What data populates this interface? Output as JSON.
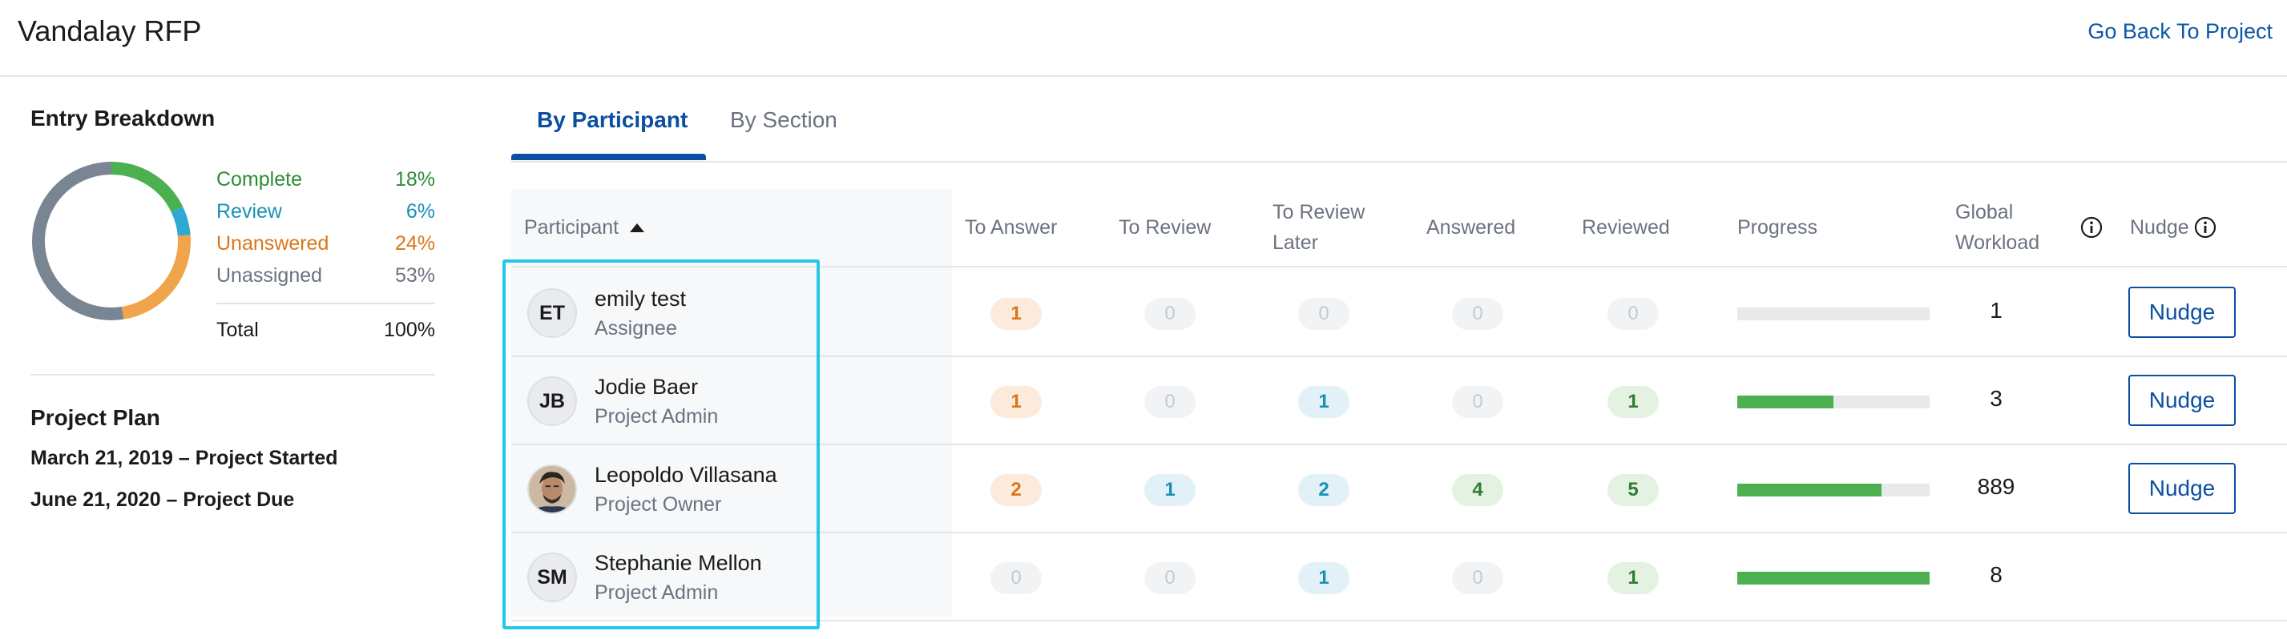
{
  "header": {
    "title": "Vandalay RFP",
    "back_link": "Go Back To Project"
  },
  "breakdown": {
    "title": "Entry Breakdown",
    "items": [
      {
        "label": "Complete",
        "percent": "18%",
        "value": 18,
        "color": "#4caf50"
      },
      {
        "label": "Review",
        "percent": "6%",
        "value": 6,
        "color": "#2eaad1"
      },
      {
        "label": "Unanswered",
        "percent": "24%",
        "value": 24,
        "color": "#f0a44b"
      },
      {
        "label": "Unassigned",
        "percent": "53%",
        "value": 53,
        "color": "#7a8593"
      }
    ],
    "total_label": "Total",
    "total_value": "100%"
  },
  "plan": {
    "title": "Project Plan",
    "started": "March 21, 2019 – Project Started",
    "due": "June 21, 2020 – Project Due"
  },
  "tabs": [
    {
      "label": "By Participant",
      "active": true
    },
    {
      "label": "By Section",
      "active": false
    }
  ],
  "table": {
    "headers": {
      "participant": "Participant",
      "to_answer": "To Answer",
      "to_review": "To Review",
      "to_review_later_1": "To Review",
      "to_review_later_2": "Later",
      "answered": "Answered",
      "reviewed": "Reviewed",
      "progress": "Progress",
      "global_workload_1": "Global",
      "global_workload_2": "Workload",
      "nudge": "Nudge"
    },
    "rows": [
      {
        "initials": "ET",
        "name": "emily test",
        "role": "Assignee",
        "to_answer": "1",
        "to_review": "0",
        "to_review_later": "0",
        "answered": "0",
        "reviewed": "0",
        "progress": 0,
        "workload": "1",
        "nudge": "Nudge"
      },
      {
        "initials": "JB",
        "name": "Jodie Baer",
        "role": "Project Admin",
        "to_answer": "1",
        "to_review": "0",
        "to_review_later": "1",
        "answered": "0",
        "reviewed": "1",
        "progress": 0.5,
        "workload": "3",
        "nudge": "Nudge"
      },
      {
        "initials": "",
        "name": "Leopoldo Villasana",
        "role": "Project Owner",
        "to_answer": "2",
        "to_review": "1",
        "to_review_later": "2",
        "answered": "4",
        "reviewed": "5",
        "progress": 0.75,
        "workload": "889",
        "nudge": "Nudge"
      },
      {
        "initials": "SM",
        "name": "Stephanie Mellon",
        "role": "Project Admin",
        "to_answer": "0",
        "to_review": "0",
        "to_review_later": "1",
        "answered": "0",
        "reviewed": "1",
        "progress": 1.0,
        "workload": "8",
        "nudge": ""
      }
    ]
  }
}
